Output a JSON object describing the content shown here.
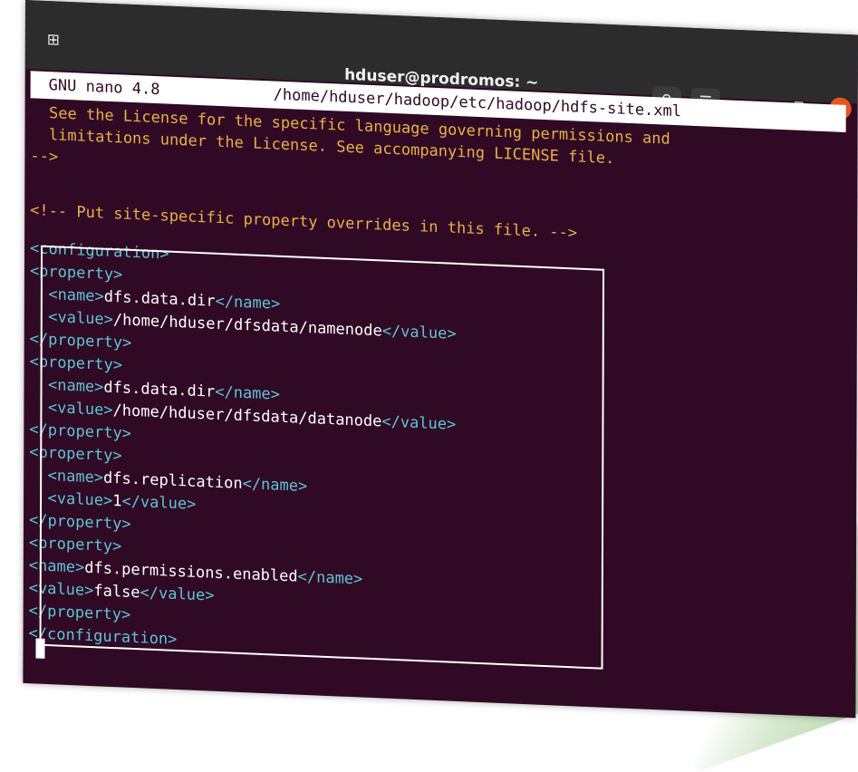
{
  "window": {
    "title": "hduser@prodromos: ~",
    "icons": {
      "new_tab": "new-tab-icon",
      "search": "search-icon",
      "menu": "hamburger-menu-icon",
      "minimize": "minimize-icon",
      "maximize": "maximize-icon",
      "close": "close-icon"
    },
    "colors": {
      "terminal_bg": "#300a24",
      "close_btn": "#e95420",
      "comment": "#e9b04a",
      "tag": "#5fc4d6"
    }
  },
  "nano": {
    "version": "GNU nano 4.8",
    "file_path": "/home/hduser/hadoop/etc/hadoop/hdfs-site.xml"
  },
  "editor": {
    "comment_lines": [
      "  See the License for the specific language governing permissions and",
      "  limitations under the License. See accompanying LICENSE file.",
      "-->",
      "",
      "<!-- Put site-specific property overrides in this file. -->"
    ],
    "config_open": "<configuration>",
    "config_close": "</configuration>",
    "property_open": "<property>",
    "property_close": "</property>",
    "properties": [
      {
        "indent": "  ",
        "name_open": "<name>",
        "name": "dfs.data.dir",
        "name_close": "</name>",
        "value_open": "<value>",
        "value": "/home/hduser/dfsdata/namenode",
        "value_close": "</value>"
      },
      {
        "indent": "  ",
        "name_open": "<name>",
        "name": "dfs.data.dir",
        "name_close": "</name>",
        "value_open": "<value>",
        "value": "/home/hduser/dfsdata/datanode",
        "value_close": "</value>"
      },
      {
        "indent": "  ",
        "name_open": "<name>",
        "name": "dfs.replication",
        "name_close": "</name>",
        "value_open": "<value>",
        "value": "1",
        "value_close": "</value>"
      },
      {
        "indent": "",
        "name_open": "<name>",
        "name": "dfs.permissions.enabled",
        "name_close": "</name>",
        "value_open": "<value>",
        "value": "false",
        "value_close": "</value>"
      }
    ]
  }
}
